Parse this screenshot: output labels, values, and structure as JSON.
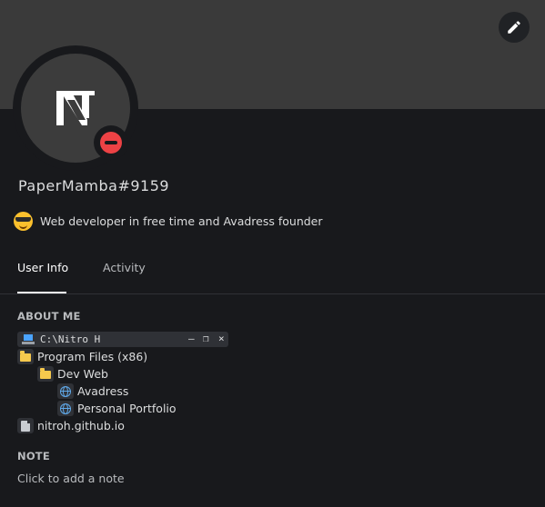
{
  "profile": {
    "username": "PaperMamba#9159",
    "status_emoji": "sunglasses-emoji",
    "custom_status": "Web developer in free time and Avadress founder",
    "presence": "do-not-disturb",
    "avatar_letter": "N"
  },
  "tabs": [
    {
      "label": "User Info",
      "active": true
    },
    {
      "label": "Activity",
      "active": false
    }
  ],
  "about": {
    "title": "ABOUT ME",
    "window_title": "C:\\Nitro H",
    "window_controls": [
      "–",
      "❐",
      "×"
    ],
    "tree": [
      {
        "label": "Program Files (x86)",
        "icon": "folder-icon"
      },
      {
        "label": "Dev Web",
        "icon": "folder-icon"
      },
      {
        "label": "Avadress",
        "icon": "globe-icon"
      },
      {
        "label": "Personal Portfolio",
        "icon": "globe-icon"
      },
      {
        "label": "nitroh.github.io",
        "icon": "page-icon"
      }
    ]
  },
  "note": {
    "title": "NOTE",
    "placeholder": "Click to add a note"
  },
  "colors": {
    "banner": "#3a3a3a",
    "background": "#18191c",
    "dnd": "#ed4245"
  }
}
